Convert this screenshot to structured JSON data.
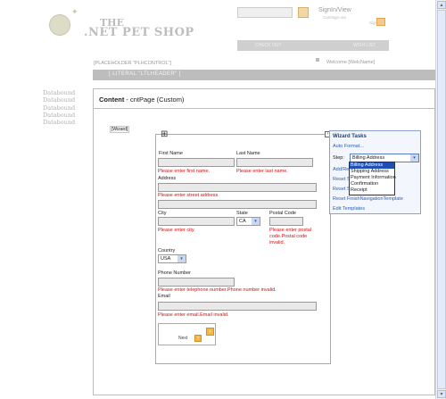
{
  "header": {
    "logo_line1": "THE",
    "logo_line2": ".NET PET SHOP",
    "search_placeholder": "",
    "go_label": "Go",
    "signin_label": "SignIn/View",
    "signin_sub": "Cart/sign-out",
    "sign_out_label": "Sign Out",
    "check_out": "CHECK OUT",
    "wish_list": "WISH LIST"
  },
  "placeholder_control": "[PLACEHOLDER \"PLHCONTROL\"]",
  "welcome": "Welcome [WelcName]",
  "literal_header": "[ LITERAL \"LTLHEADER\" ]",
  "databound_items": [
    "Databound",
    "Databound",
    "Databound",
    "Databound",
    "Databound"
  ],
  "content_header": {
    "label_bold": "Content",
    "label_rest": " - cntPage (Custom)"
  },
  "wizard_tag": "[Wizard]",
  "form": {
    "first_name": "First Name",
    "last_name": "Last Name",
    "err_first": "Please enter first name.",
    "err_last": "Please enter last name.",
    "address": "Address",
    "err_address": "Please enter street address.",
    "city": "City",
    "state": "State",
    "state_value": "CA",
    "postal_code": "Postal Code",
    "err_city": "Please enter city.",
    "err_postal": "Please enter postal code.Postal code invalid.",
    "country": "Country",
    "country_value": "USA",
    "phone": "Phone Number",
    "err_phone": "Please enter telephone number.Phone number invalid.",
    "email": "Email",
    "err_email": "Please enter email.Email invalid.",
    "next_label": "Next"
  },
  "wizard_tasks": {
    "title": "Wizard Tasks",
    "auto_format": "Auto Format...",
    "step_label": "Step:",
    "step_value": "Billing Address",
    "add_remove": "Add/Re",
    "reset1": "Reset S",
    "reset2": "Reset S",
    "reset_finish": "Reset FinishNavigationTemplate",
    "edit_templates": "Edit Templates",
    "options": [
      "Billing Address",
      "Shipping Address",
      "Payment Information",
      "Confirmation",
      "Receipt"
    ],
    "selected_index": 0
  },
  "colors": {
    "accent_blue": "#2a5fb0",
    "dropdown_select": "#1f4fb5",
    "error_red": "#d01010",
    "cart_orange": "#f2a23a"
  }
}
